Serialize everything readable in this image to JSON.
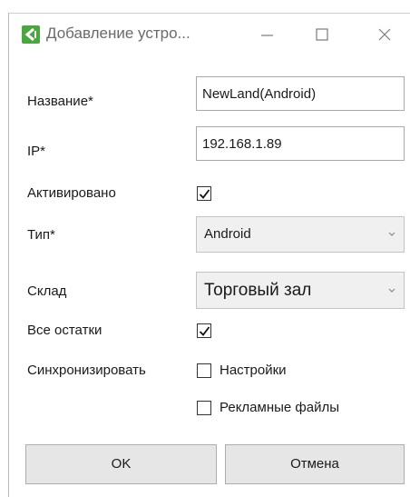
{
  "window": {
    "title": "Добавление устро..."
  },
  "form": {
    "name": {
      "label": "Название*",
      "value": "NewLand(Android)"
    },
    "ip": {
      "label": "IP*",
      "value": "192.168.1.89"
    },
    "activated": {
      "label": "Активировано",
      "checked": true
    },
    "type": {
      "label": "Тип*",
      "value": "Android"
    },
    "warehouse": {
      "label": "Склад",
      "value": "Торговый зал"
    },
    "all_stock": {
      "label": "Все остатки",
      "checked": true
    },
    "sync": {
      "label": "Синхронизировать",
      "options": [
        {
          "label": "Настройки",
          "checked": false
        },
        {
          "label": "Рекламные файлы",
          "checked": false
        }
      ]
    }
  },
  "buttons": {
    "ok": "OK",
    "cancel": "Отмена"
  },
  "colors": {
    "app_icon": "#4aa63f",
    "button_bg": "#e6e6e6",
    "select_bg": "#f0f0f0"
  }
}
